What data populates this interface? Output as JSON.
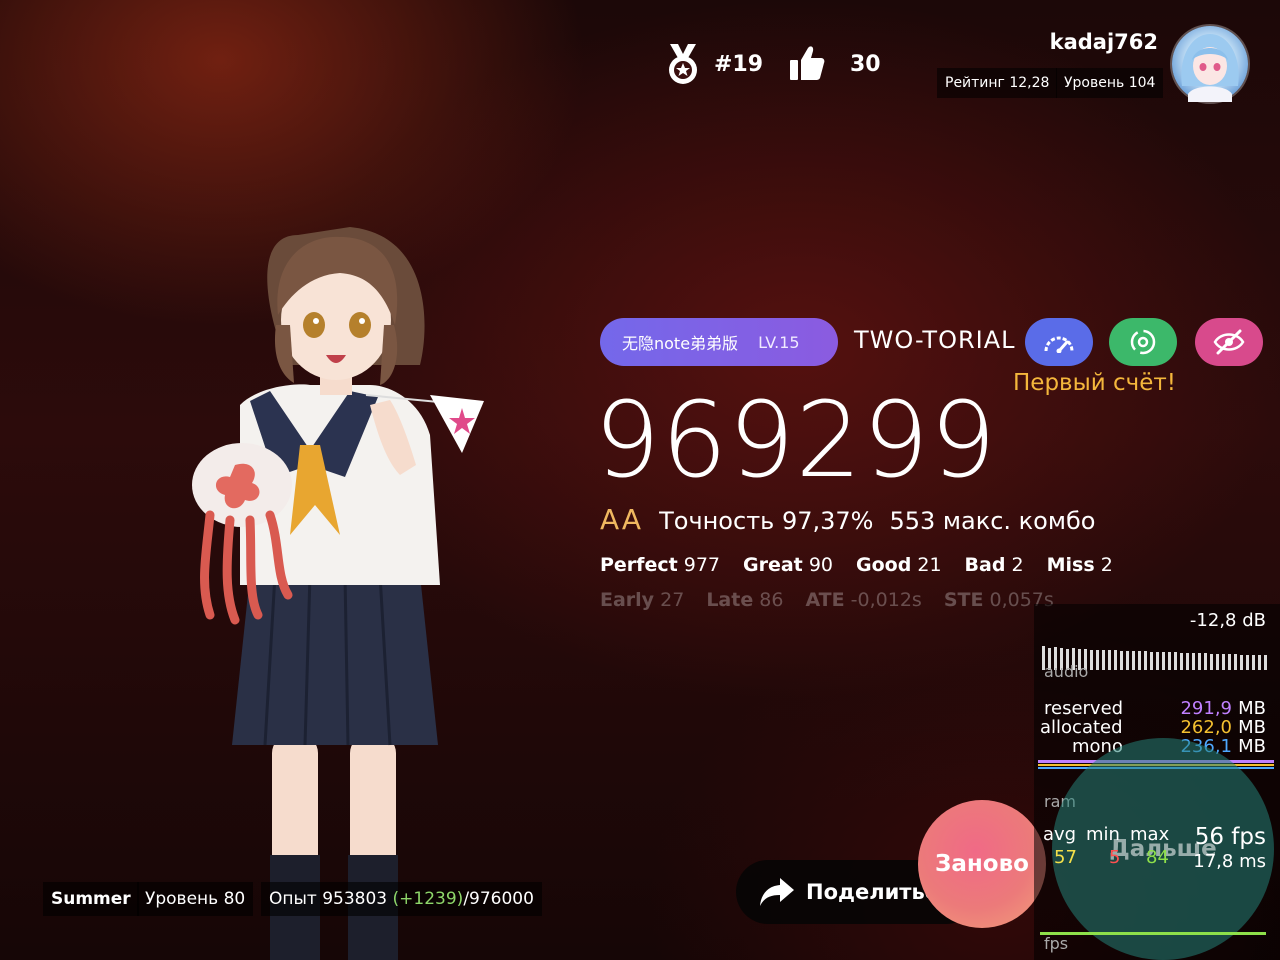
{
  "header": {
    "rank": "#19",
    "likes": "30",
    "username": "kadaj762",
    "rating": "Рейтинг 12,28",
    "level": "Уровень 104"
  },
  "song": {
    "title": "无隐note弟弟版",
    "level": "LV.15",
    "difficulty": "TWO-TORIAL",
    "first_score_label": "Первый счёт!"
  },
  "result": {
    "score": "969299",
    "grade": "AA",
    "accuracy": "Точность 97,37%",
    "max_combo": "553 макс. комбо",
    "judgements": [
      {
        "label": "Perfect",
        "value": "977"
      },
      {
        "label": "Great",
        "value": "90"
      },
      {
        "label": "Good",
        "value": "21"
      },
      {
        "label": "Bad",
        "value": "2"
      },
      {
        "label": "Miss",
        "value": "2"
      }
    ],
    "timing": [
      {
        "label": "Early",
        "value": "27"
      },
      {
        "label": "Late",
        "value": "86"
      },
      {
        "label": "ATE",
        "value": "-0,012s"
      },
      {
        "label": "STE",
        "value": "0,057s"
      }
    ]
  },
  "player": {
    "name": "Summer",
    "level": "Уровень 80",
    "exp_prefix": "Опыт 953803",
    "exp_gain": "(+1239)",
    "exp_total": "/976000"
  },
  "actions": {
    "share": "Поделиться",
    "retry": "Заново",
    "next": "Дальше"
  },
  "debug": {
    "db": "-12,8 dB",
    "audio_label": "audio",
    "reserved_label": "reserved",
    "reserved": "291,9",
    "allocated_label": "allocated",
    "allocated": "262,0",
    "mono_label": "mono",
    "mono": "236,1",
    "unit": "MB",
    "ram_label": "ram",
    "avg_label": "avg",
    "min_label": "min",
    "max_label": "max",
    "avg": "57",
    "min": "5",
    "max": "84",
    "fps": "56 fps",
    "ms": "17,8 ms",
    "fps_label": "fps"
  },
  "colors": {
    "song_chip": "#7b64e8",
    "mod_speed": "#5a6ce8",
    "mod_sync": "#3cb86a",
    "mod_hidden": "#d84a8c",
    "first_score": "#f4b73c",
    "grade": "#f0b860",
    "exp_gain": "#8ed66a",
    "reserved": "#c080ff",
    "allocated": "#f4c030",
    "mono": "#4ea8ff"
  }
}
